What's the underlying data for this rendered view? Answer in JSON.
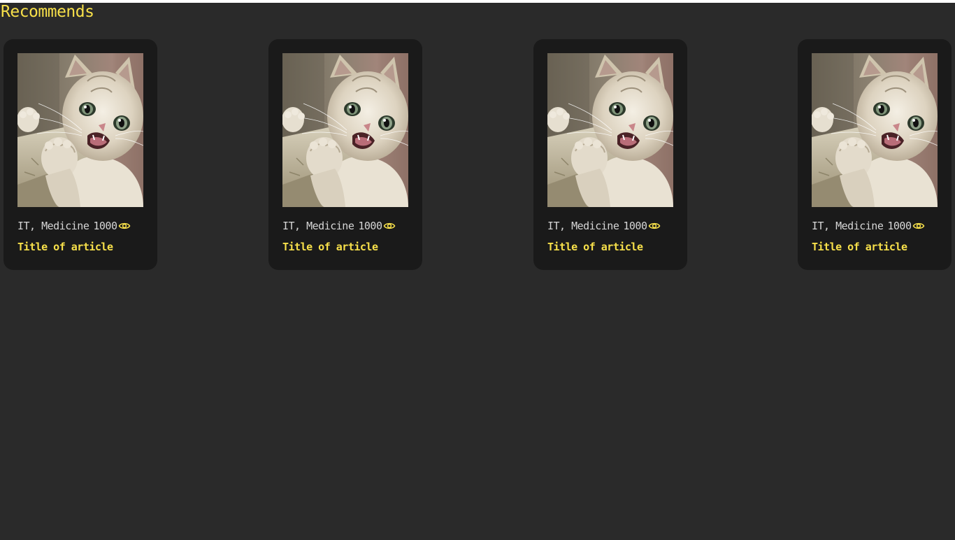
{
  "section": {
    "title": "Recommends"
  },
  "cards": [
    {
      "tags": "IT, Medicine",
      "views": "1000",
      "title": "Title of article",
      "image_icon": "cat-photo"
    },
    {
      "tags": "IT, Medicine",
      "views": "1000",
      "title": "Title of article",
      "image_icon": "cat-photo"
    },
    {
      "tags": "IT, Medicine",
      "views": "1000",
      "title": "Title of article",
      "image_icon": "cat-photo"
    },
    {
      "tags": "IT, Medicine",
      "views": "1000",
      "title": "Title of article",
      "image_icon": "cat-photo"
    }
  ],
  "colors": {
    "background": "#2a2a2a",
    "card": "#1a1a1a",
    "accent": "#f7e04a",
    "meta_text": "#d6d6d6"
  }
}
